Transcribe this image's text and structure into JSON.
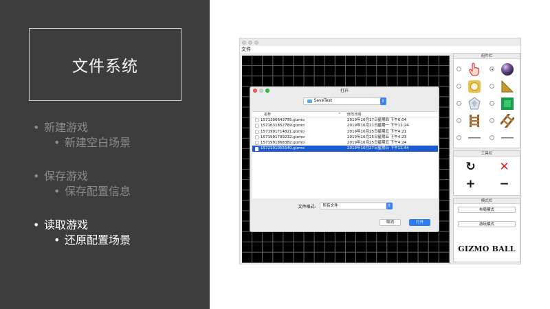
{
  "slide": {
    "title": "文件系统",
    "bullets": [
      {
        "main": "新建游戏",
        "sub": "新建空白场景"
      },
      {
        "main": "保存游戏",
        "sub": "保存配置信息"
      },
      {
        "main": "读取游戏",
        "sub": "还原配置场景"
      }
    ]
  },
  "app": {
    "menu_label": "文件",
    "panels": {
      "components_title": "组件栏",
      "tools_title": "工具栏",
      "mode_title": "模式栏"
    },
    "components": [
      {
        "icon": "hand-pointer-icon",
        "selected": false
      },
      {
        "icon": "purple-ball-icon",
        "selected": true
      },
      {
        "icon": "gold-circle-icon",
        "selected": false
      },
      {
        "icon": "gold-triangle-icon",
        "selected": false
      },
      {
        "icon": "diamond-icon",
        "selected": false
      },
      {
        "icon": "green-square-icon",
        "selected": false
      },
      {
        "icon": "ladder-icon",
        "selected": false
      },
      {
        "icon": "diagonal-rail-icon",
        "selected": false
      },
      {
        "icon": "left-flipper-icon",
        "selected": false
      },
      {
        "icon": "right-flipper-icon",
        "selected": false
      }
    ],
    "tools": [
      {
        "icon": "rotate-icon",
        "glyph": "↻"
      },
      {
        "icon": "delete-icon",
        "glyph": "✕"
      },
      {
        "icon": "zoom-in-icon",
        "glyph": "+"
      },
      {
        "icon": "zoom-out-icon",
        "glyph": "−"
      }
    ],
    "mode_buttons": {
      "layout": "布局模式",
      "play": "游玩模式"
    },
    "logo": "GIZMO BALL"
  },
  "dialog": {
    "title": "打开",
    "directory": "SaveTest",
    "columns": {
      "name": "名称",
      "date": "修改日期"
    },
    "files": [
      {
        "name": "1571306643755.gizmo",
        "date": "2019年10月17日星期四 下午6:04",
        "selected": false
      },
      {
        "name": "1571631852769.gizmo",
        "date": "2019年10月21日星期一 下午12:24",
        "selected": false
      },
      {
        "name": "1571991714821.gizmo",
        "date": "2019年10月25日星期五 下午4:21",
        "selected": false
      },
      {
        "name": "1571991799232.gizmo",
        "date": "2019年10月25日星期五 下午4:23",
        "selected": false
      },
      {
        "name": "1571991868382.gizmo",
        "date": "2019年10月25日星期五 下午4:24",
        "selected": false
      },
      {
        "name": "1572191055540.gizmo",
        "date": "2019年10月27日星期日 下午11:44",
        "selected": true
      }
    ],
    "format_label": "文件格式:",
    "format_value": "所有文件",
    "cancel_label": "取消",
    "open_label": "打开"
  },
  "colors": {
    "slide_bg": "#3d3d3d",
    "accent": "#2d7cf6",
    "selection": "#1d5ad0"
  }
}
